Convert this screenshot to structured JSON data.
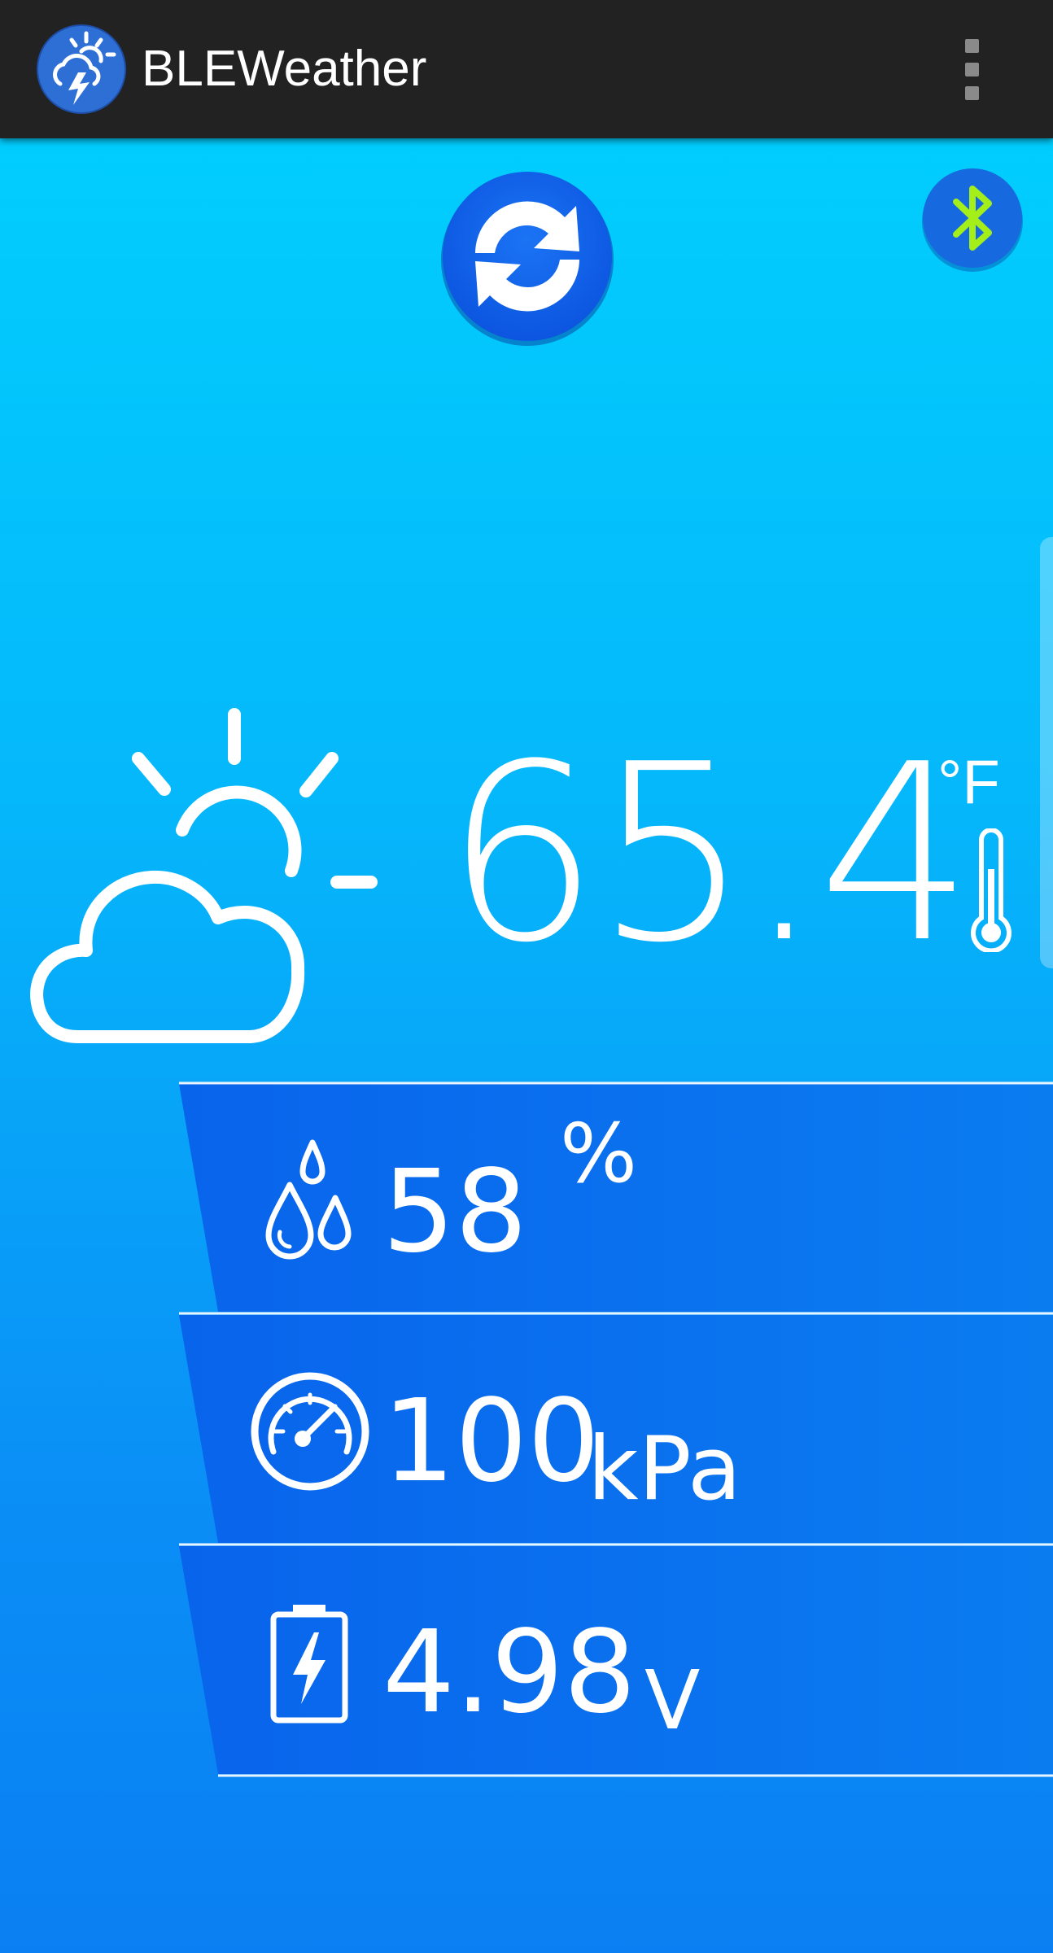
{
  "app": {
    "title": "BLEWeather",
    "icon": "weather-app-logo-icon",
    "menu_icon": "overflow-menu-icon"
  },
  "controls": {
    "refresh_icon": "refresh-icon",
    "bluetooth_icon": "bluetooth-icon"
  },
  "colors": {
    "appbar": "#222222",
    "background_top": "#00d2fe",
    "background_bottom": "#0a7ff3",
    "refresh_button": "#0f62ee",
    "bluetooth_button": "#1769e0",
    "bluetooth_glyph": "#a4ef1a",
    "panel": "#0874ee"
  },
  "weather": {
    "condition_icon": "partly-cloudy-icon",
    "temperature": "65.4",
    "temperature_unit": "°F",
    "thermometer_icon": "thermometer-icon"
  },
  "stats": {
    "humidity": {
      "value": "58",
      "unit": "%",
      "icon": "humidity-drops-icon"
    },
    "pressure": {
      "value": "100",
      "unit": "kPa",
      "icon": "pressure-gauge-icon"
    },
    "voltage": {
      "value": "4.98",
      "unit": "V",
      "icon": "battery-charge-icon"
    }
  }
}
